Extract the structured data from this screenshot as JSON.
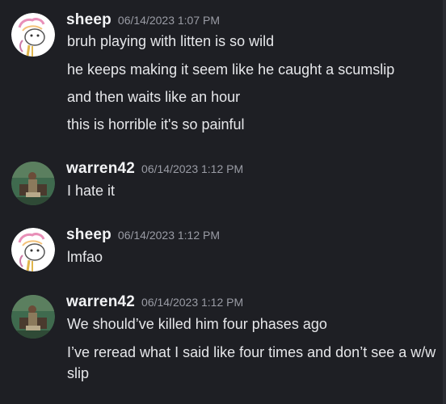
{
  "messages": [
    {
      "username": "sheep",
      "timestamp": "06/14/2023 1:07 PM",
      "avatar_icon": "sheep-avatar-icon",
      "lines": [
        "bruh playing with litten is so wild",
        "he keeps making it seem like he caught a scumslip",
        "and then waits like an hour",
        "this is horrible it's so painful"
      ]
    },
    {
      "username": "warren42",
      "timestamp": "06/14/2023 1:12 PM",
      "avatar_icon": "photo-avatar-icon",
      "lines": [
        "I hate it"
      ]
    },
    {
      "username": "sheep",
      "timestamp": "06/14/2023 1:12 PM",
      "avatar_icon": "sheep-avatar-icon",
      "lines": [
        "lmfao"
      ]
    },
    {
      "username": "warren42",
      "timestamp": "06/14/2023 1:12 PM",
      "avatar_icon": "photo-avatar-icon",
      "lines": [
        "We should’ve killed him four phases ago",
        "I’ve reread what I said like four times and don’t see a w/w slip"
      ]
    }
  ],
  "colors": {
    "background": "#1e1f24",
    "username": "#f2f3f5",
    "timestamp": "#9a9ca5",
    "text": "#e6e7ea"
  }
}
